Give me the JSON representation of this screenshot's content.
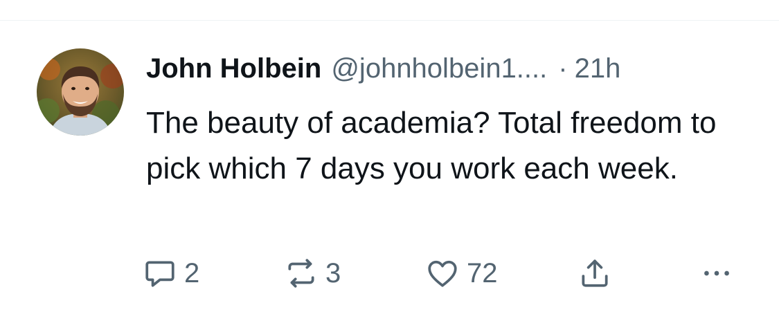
{
  "tweet": {
    "author_name": "John Holbein",
    "handle": "@johnholbein1....",
    "separator": "·",
    "time": "21h",
    "text": "The beauty of academia? Total freedom to pick which 7 days you work each week."
  },
  "actions": {
    "replies": "2",
    "retweets": "3",
    "likes": "72"
  },
  "icons": {
    "reply": "comment-icon",
    "retweet": "retweet-icon",
    "like": "heart-icon",
    "share": "share-icon",
    "more": "more-icon"
  },
  "colors": {
    "text": "#0f1419",
    "secondary": "#536471",
    "divider": "#eff3f4"
  }
}
